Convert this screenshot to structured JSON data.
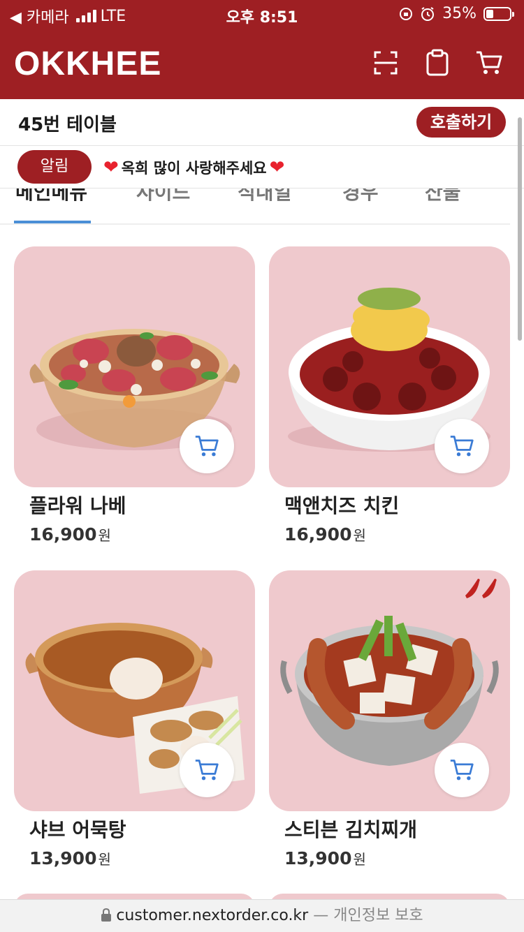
{
  "status_bar": {
    "back_label": "◀ 카메라",
    "network": "LTE",
    "time": "오후 8:51",
    "battery": "35%"
  },
  "header": {
    "logo": "OKKHEE",
    "icons": [
      "scan-icon",
      "clipboard-icon",
      "cart-icon"
    ]
  },
  "table_bar": {
    "table_name": "45번 테이블",
    "call_label": "호출하기"
  },
  "notice": {
    "badge": "알림",
    "message": "옥희 많이 사랑해주세요"
  },
  "tabs": [
    {
      "label": "메인메뉴",
      "active": true
    },
    {
      "label": "사이드",
      "active": false
    },
    {
      "label": "식내일",
      "active": false
    },
    {
      "label": "경우",
      "active": false
    },
    {
      "label": "산물",
      "active": false
    }
  ],
  "menu": [
    {
      "name": "플라워 나베",
      "price": "16,900",
      "unit": "원",
      "spicy": false
    },
    {
      "name": "맥앤치즈 치킨",
      "price": "16,900",
      "unit": "원",
      "spicy": false
    },
    {
      "name": "샤브 어묵탕",
      "price": "13,900",
      "unit": "원",
      "spicy": false
    },
    {
      "name": "스티븐 김치찌개",
      "price": "13,900",
      "unit": "원",
      "spicy": true
    }
  ],
  "url_bar": {
    "url": "customer.nextorder.co.kr",
    "suffix": "— 개인정보 보호"
  },
  "colors": {
    "brand": "#9e1f23",
    "card_bg": "#efc9cd",
    "tab_indicator": "#4a8fd6",
    "cart_icon": "#3a7bd5"
  }
}
